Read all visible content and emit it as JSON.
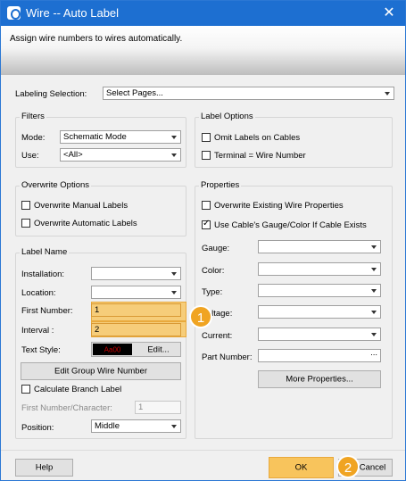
{
  "window": {
    "title": "Wire -- Auto Label",
    "close_glyph": "✕"
  },
  "banner": {
    "text": "Assign wire numbers to wires automatically."
  },
  "labeling": {
    "label": "Labeling Selection:",
    "value": "Select Pages..."
  },
  "filters": {
    "title": "Filters",
    "mode_label": "Mode:",
    "mode_value": "Schematic Mode",
    "use_label": "Use:",
    "use_value": "<All>"
  },
  "label_options": {
    "title": "Label Options",
    "omit_cables": "Omit Labels on Cables",
    "terminal_wire": "Terminal = Wire Number"
  },
  "overwrite_options": {
    "title": "Overwrite Options",
    "manual": "Overwrite Manual Labels",
    "automatic": "Overwrite Automatic Labels"
  },
  "properties": {
    "title": "Properties",
    "overwrite_existing": "Overwrite Existing Wire Properties",
    "use_cable": "Use Cable's Gauge/Color If Cable Exists",
    "gauge": "Gauge:",
    "color": "Color:",
    "type": "Type:",
    "voltage": "Voltage:",
    "current": "Current:",
    "part_number": "Part Number:",
    "part_number_ellipsis": "...",
    "more_button": "More Properties..."
  },
  "label_name": {
    "title": "Label Name",
    "installation": "Installation:",
    "location": "Location:",
    "first_number_label": "First Number:",
    "first_number_value": "1",
    "interval_label": "Interval :",
    "interval_value": "2",
    "text_style_label": "Text Style:",
    "text_style_sample": "Aa00",
    "edit_button": "Edit...",
    "edit_group_button": "Edit Group Wire Number",
    "calc_branch": "Calculate Branch Label",
    "first_char_label": "First Number/Character:",
    "first_char_value": "1",
    "position_label": "Position:",
    "position_value": "Middle"
  },
  "footer": {
    "help": "Help",
    "ok": "OK",
    "cancel": "Cancel"
  },
  "callouts": {
    "one": "1",
    "two": "2"
  },
  "colors": {
    "accent": "#1d6fd1",
    "highlight": "#f8c45c",
    "badge": "#f0a422"
  }
}
